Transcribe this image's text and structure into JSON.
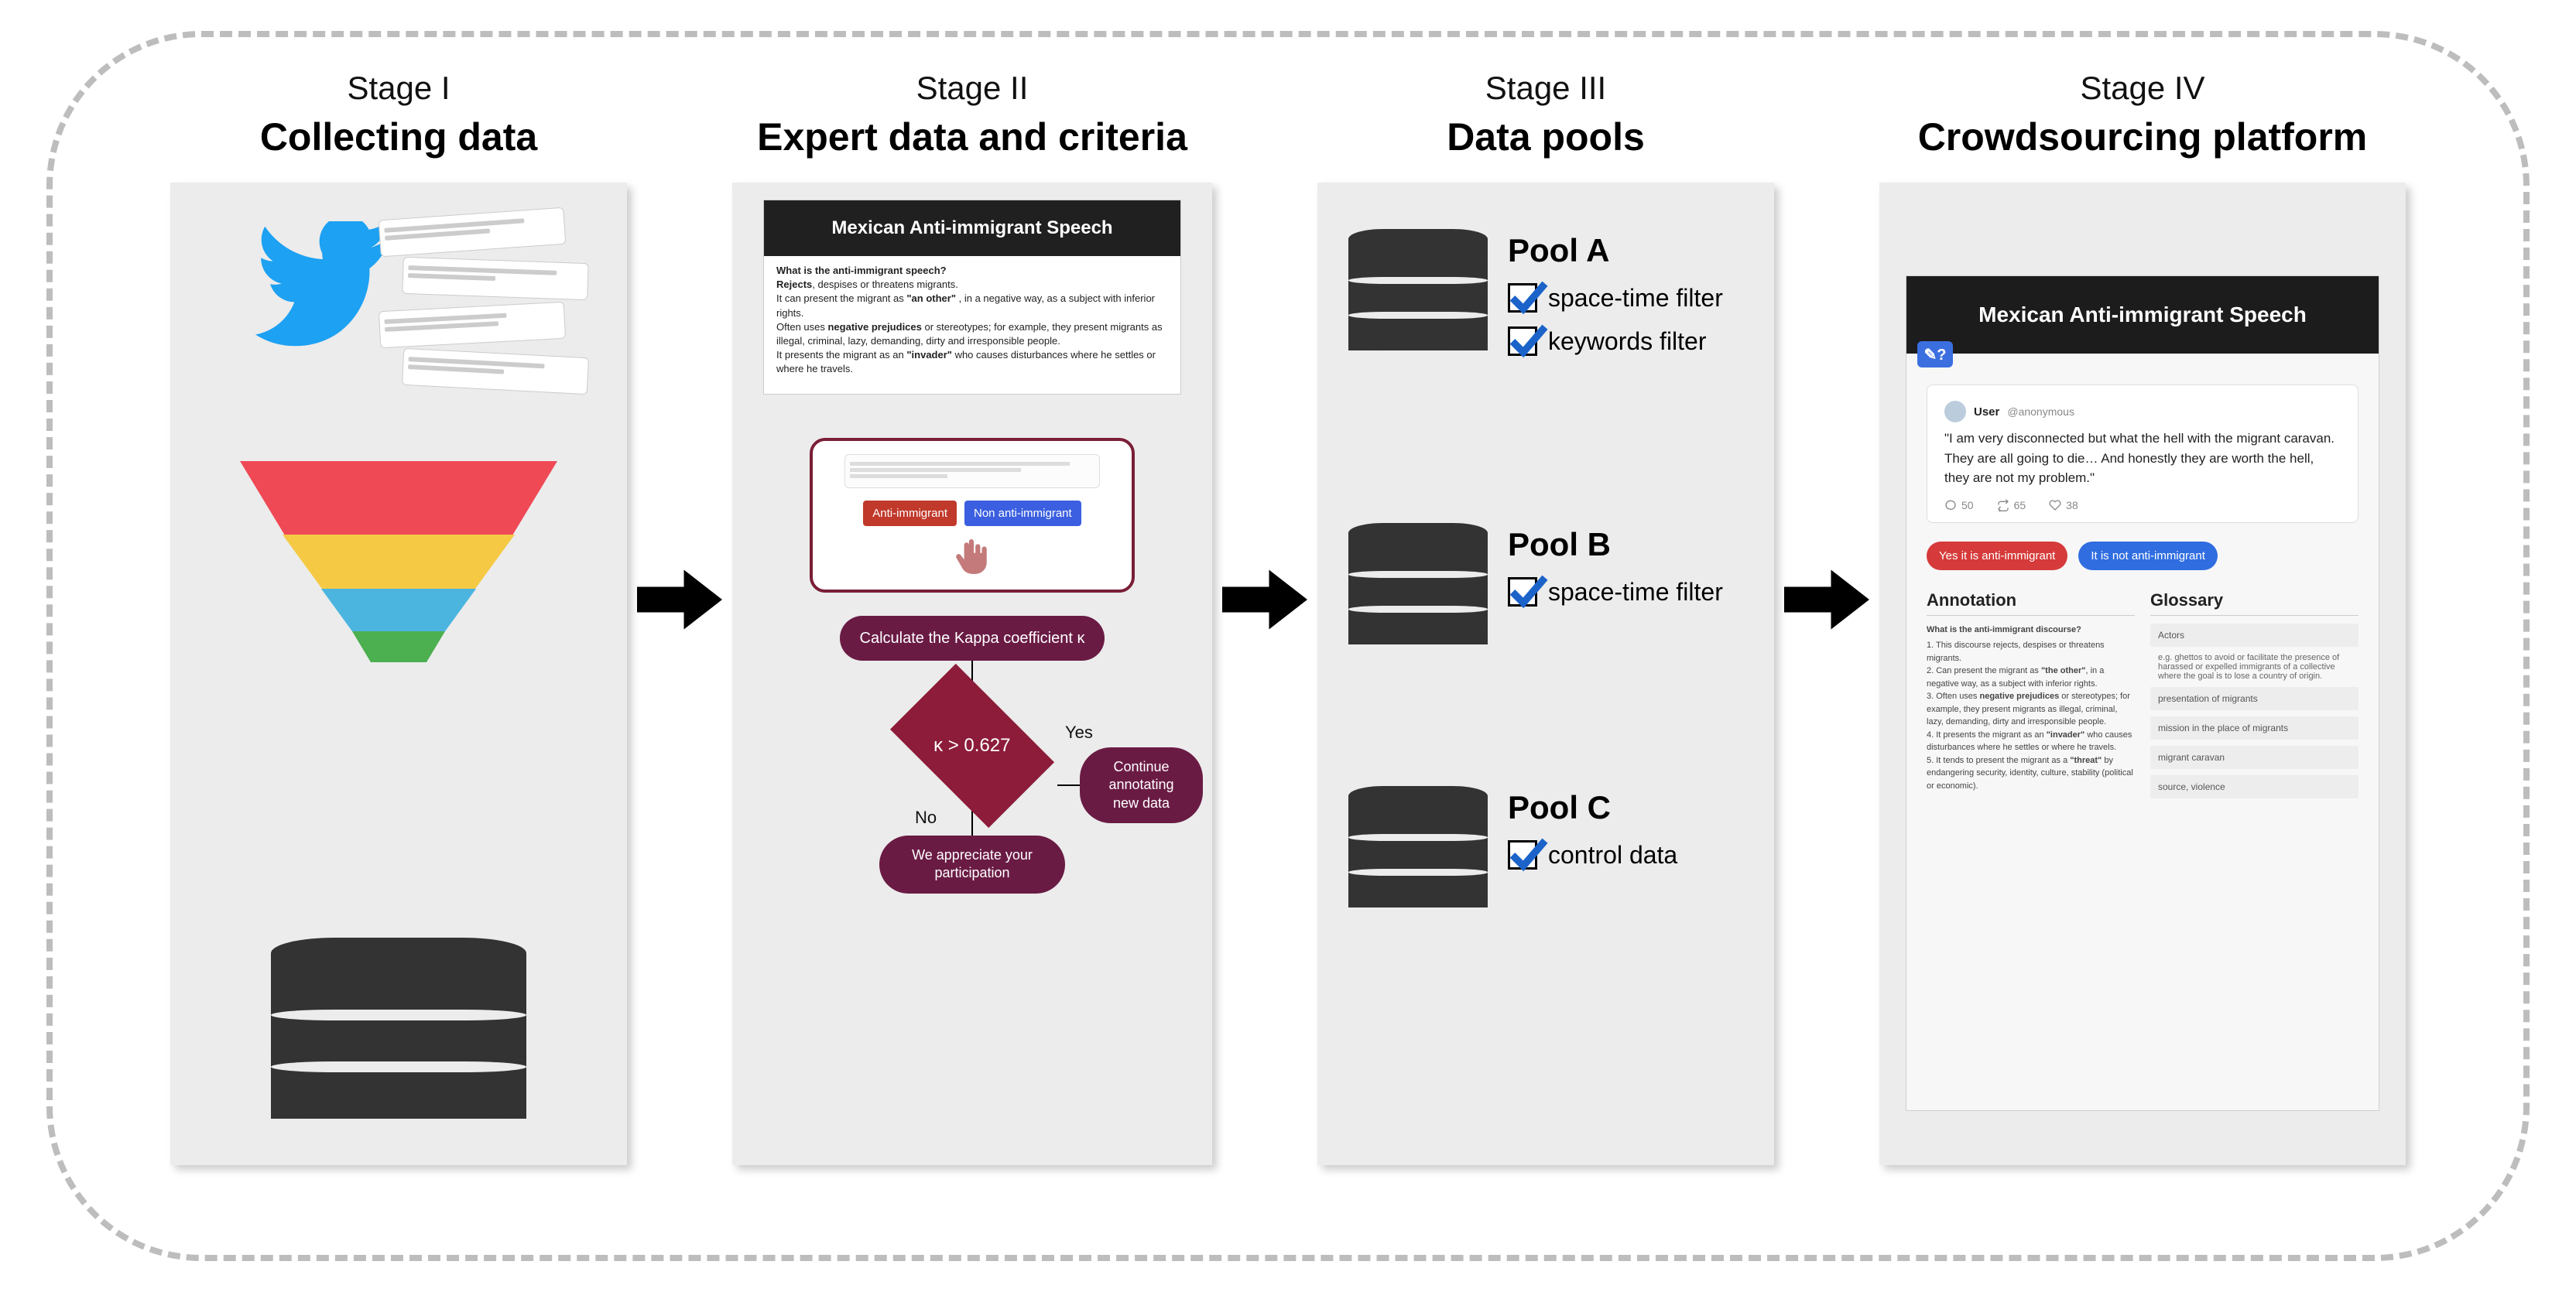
{
  "stages": {
    "s1": {
      "label": "Stage I",
      "title": "Collecting data"
    },
    "s2": {
      "label": "Stage II",
      "title": "Expert data and criteria"
    },
    "s3": {
      "label": "Stage III",
      "title": "Data pools"
    },
    "s4": {
      "label": "Stage IV",
      "title": "Crowdsourcing platform"
    }
  },
  "stage2": {
    "card_title": "Mexican Anti-immigrant Speech",
    "q": "What is the anti-immigrant speech?",
    "line1a": "Rejects",
    "line1b": ", despises or threatens migrants.",
    "line2a": "It can present the migrant as ",
    "line2b": "\"an other\"",
    "line2c": " , in a negative way, as a subject with inferior rights.",
    "line3a": "Often uses ",
    "line3b": "negative prejudices",
    "line3c": " or stereotypes; for example, they present migrants as illegal, criminal, lazy, demanding, dirty and irresponsible people.",
    "line4a": "It presents the migrant as an ",
    "line4b": "\"invader\"",
    "line4c": " who causes disturbances where he settles or where he travels.",
    "btn_red": "Anti-immigrant",
    "btn_blue": "Non anti-immigrant",
    "calc": "Calculate the Kappa coefficient  κ",
    "cond": "κ > 0.627",
    "yes": "Yes",
    "no": "No",
    "yes_out": "Continue annotating new data",
    "no_out": "We appreciate your participation"
  },
  "stage3": {
    "poolA": {
      "name": "Pool A",
      "f1": "space-time filter",
      "f2": "keywords filter"
    },
    "poolB": {
      "name": "Pool B",
      "f1": "space-time filter"
    },
    "poolC": {
      "name": "Pool C",
      "f1": "control data"
    }
  },
  "stage4": {
    "title": "Mexican Anti-immigrant Speech",
    "handle_icon": "✎?",
    "user": "User",
    "user_handle": "@anonymous",
    "tweet": "\"I am very disconnected but what the hell with the migrant caravan. They are all going to die… And honestly they are worth the hell, they are not my problem.\"",
    "actions": {
      "reply": "50",
      "retweet": "65",
      "like": "38"
    },
    "btn_yes": "Yes it is anti-immigrant",
    "btn_no": "It is not anti-immigrant",
    "annotation": {
      "heading": "Annotation",
      "sub": "What is the anti-immigrant discourse?",
      "i1": "1. This discourse rejects, despises or threatens migrants.",
      "i2a": "2. Can present the migrant as ",
      "i2b": "\"the other\"",
      "i2c": ", in a negative way, as a subject with inferior rights.",
      "i3a": "3. Often uses ",
      "i3b": "negative prejudices",
      "i3c": " or stereotypes; for example, they present migrants as illegal, criminal, lazy, demanding, dirty and irresponsible people.",
      "i4a": "4. It presents the migrant as an ",
      "i4b": "\"invader\"",
      "i4c": " who causes disturbances where he settles or where he travels.",
      "i5a": "5. It tends to present the migrant as a ",
      "i5b": "\"threat\"",
      "i5c": " by endangering security, identity, culture, stability (political or economic)."
    },
    "glossary": {
      "heading": "Glossary",
      "g1": "Actors",
      "g1sub": "e.g. ghettos to avoid or facilitate the presence of harassed or expelled immigrants of a collective where the goal is to lose a country of origin.",
      "g2": "presentation of migrants",
      "g3": "mission in the place of migrants",
      "g4": "migrant caravan",
      "g5": "source, violence"
    }
  }
}
